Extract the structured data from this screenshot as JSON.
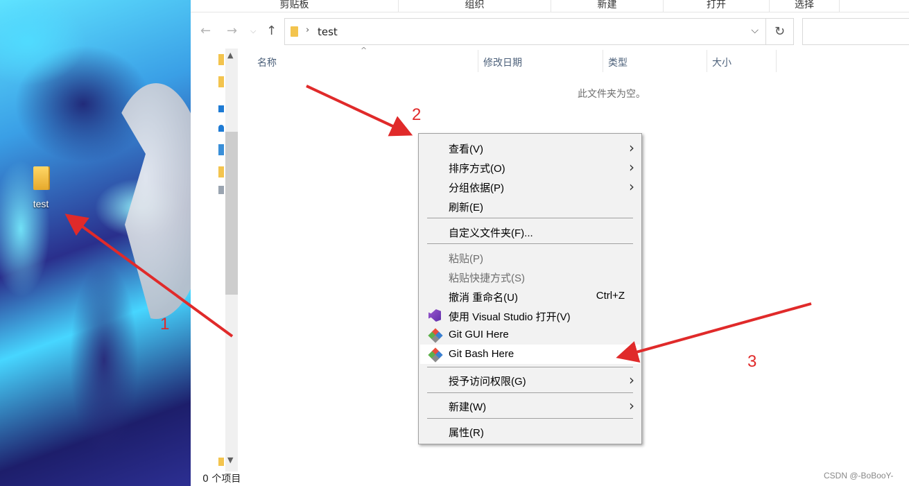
{
  "desktop": {
    "folder_label": "test"
  },
  "ribbon": {
    "groups": [
      "剪贴板",
      "组织",
      "新建",
      "打开",
      "选择"
    ]
  },
  "address_bar": {
    "path_segment": "test",
    "separator": "›"
  },
  "columns": {
    "name": "名称",
    "modified": "修改日期",
    "type": "类型",
    "size": "大小"
  },
  "content": {
    "empty_message": "此文件夹为空。"
  },
  "status_bar": {
    "item_count": "0 个项目"
  },
  "context_menu": {
    "items": [
      {
        "label": "查看(V)",
        "submenu": true
      },
      {
        "label": "排序方式(O)",
        "submenu": true
      },
      {
        "label": "分组依据(P)",
        "submenu": true
      },
      {
        "label": "刷新(E)"
      },
      {
        "label": "自定义文件夹(F)..."
      },
      {
        "label": "粘贴(P)",
        "disabled": true
      },
      {
        "label": "粘贴快捷方式(S)",
        "disabled": true
      },
      {
        "label": "撤消 重命名(U)",
        "shortcut": "Ctrl+Z"
      },
      {
        "label": "使用 Visual Studio 打开(V)",
        "icon": "visual-studio-icon"
      },
      {
        "label": "Git GUI Here",
        "icon": "git-icon"
      },
      {
        "label": "Git Bash Here",
        "icon": "git-icon",
        "highlighted": true
      },
      {
        "label": "授予访问权限(G)",
        "submenu": true
      },
      {
        "label": "新建(W)",
        "submenu": true
      },
      {
        "label": "属性(R)"
      }
    ],
    "submenu_arrow": "›"
  },
  "annotations": {
    "step1": "1",
    "step2": "2",
    "step3": "3",
    "arrow_color": "#e02a2a"
  },
  "watermark": "CSDN @-BoBooY-"
}
